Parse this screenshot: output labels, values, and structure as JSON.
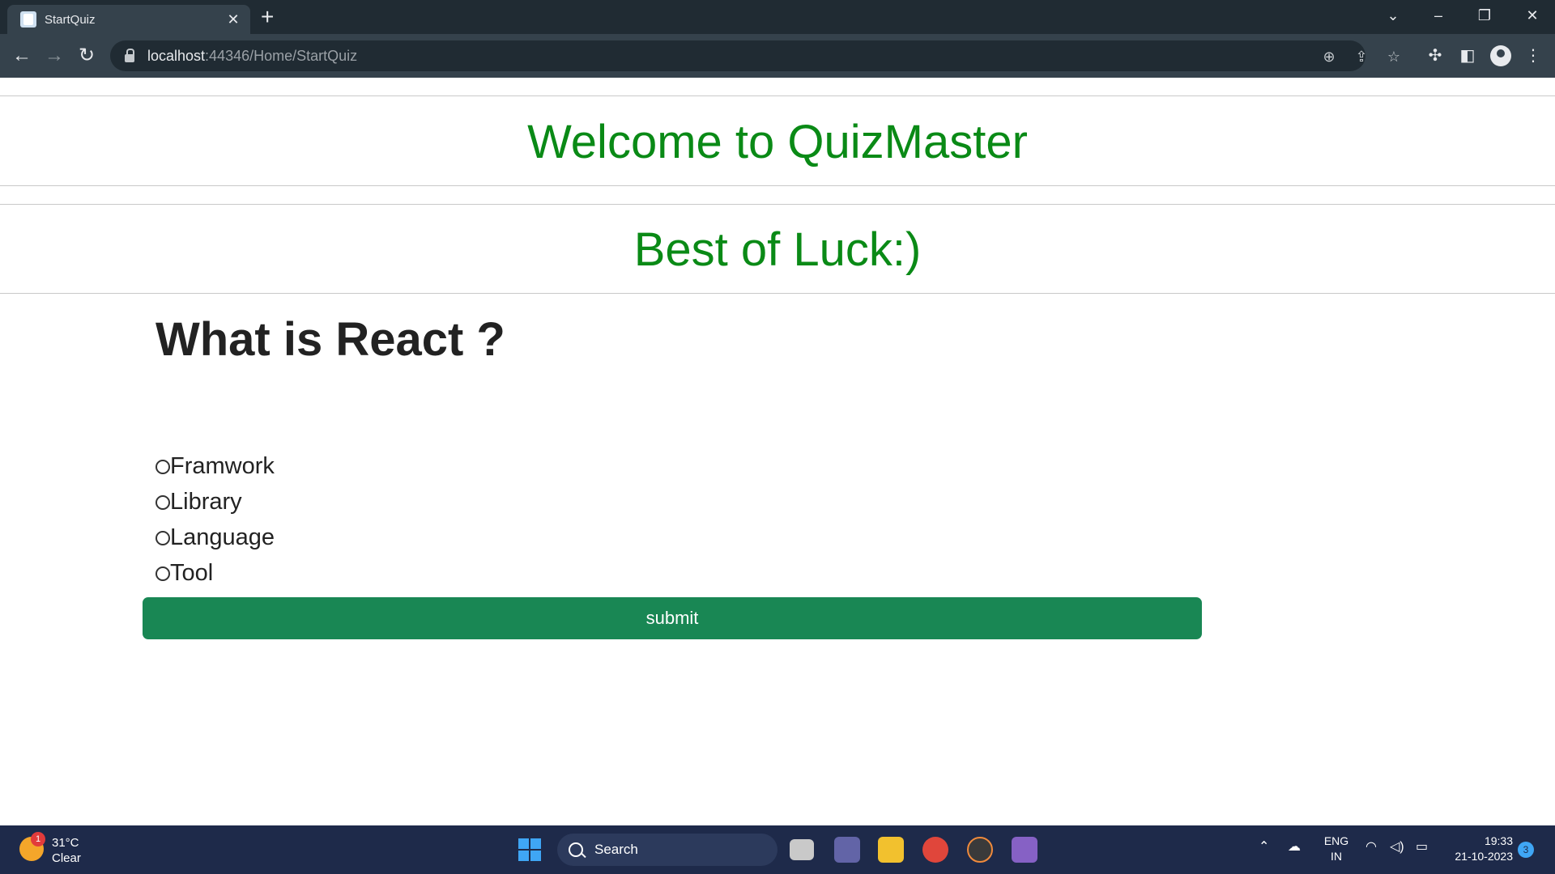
{
  "browser": {
    "tab_title": "StartQuiz",
    "url_host": "localhost",
    "url_path": ":44346/Home/StartQuiz"
  },
  "page": {
    "welcome": "Welcome to QuizMaster",
    "luck": "Best of Luck:)",
    "question": "What is React ?",
    "options": [
      {
        "label": "Framwork"
      },
      {
        "label": "Library"
      },
      {
        "label": "Language"
      },
      {
        "label": "Tool"
      }
    ],
    "submit_label": "submit"
  },
  "colors": {
    "heading": "#0a8a16",
    "submit_bg": "#198754"
  },
  "taskbar": {
    "weather_badge": "1",
    "weather_temp": "31°C",
    "weather_desc": "Clear",
    "search_label": "Search",
    "lang_line1": "ENG",
    "lang_line2": "IN",
    "time": "19:33",
    "date": "21-10-2023",
    "notif_count": "3"
  }
}
